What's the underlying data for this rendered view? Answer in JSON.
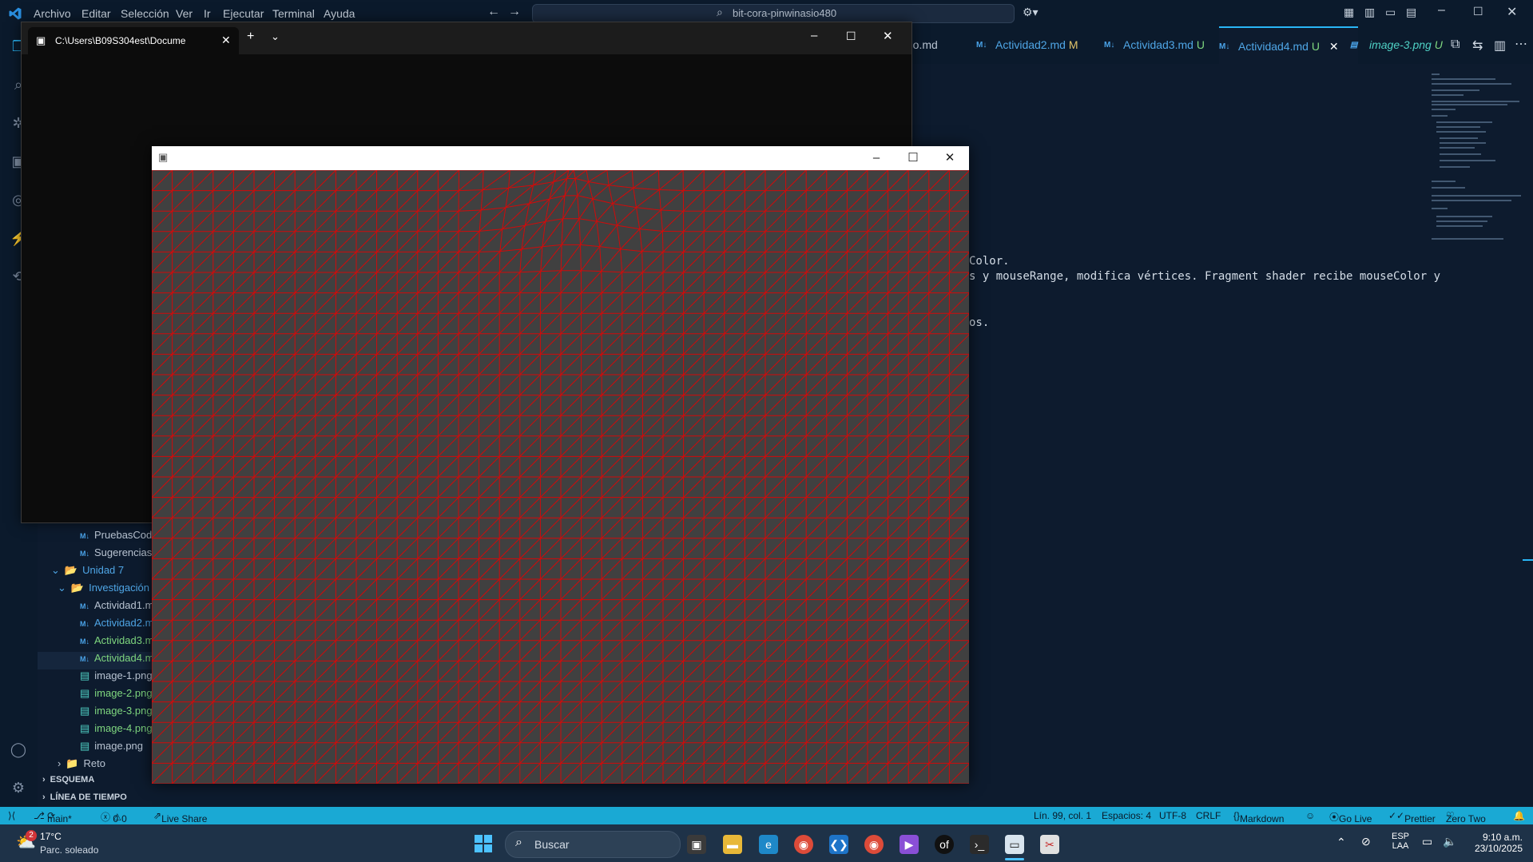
{
  "titlebar": {
    "menus": [
      "Archivo",
      "Editar",
      "Selección",
      "Ver",
      "Ir",
      "Ejecutar",
      "Terminal",
      "Ayuda"
    ],
    "search": "bit-cora-pinwinasio480"
  },
  "tabs": [
    {
      "label": "digo.md",
      "state": ""
    },
    {
      "label": "Actividad2.md",
      "state": "M"
    },
    {
      "label": "Actividad3.md",
      "state": "U"
    },
    {
      "label": "Actividad4.md",
      "state": "U",
      "active": true
    },
    {
      "label": "image-3.png",
      "state": "U"
    }
  ],
  "editor": {
    "lines": [
      "Color.",
      "s y mouseRange, modifica vértices. Fragment shader recibe mouseColor y",
      "os."
    ]
  },
  "explorer": {
    "items": [
      {
        "label": "PruebasCod",
        "kind": "md"
      },
      {
        "label": "Sugerencias",
        "kind": "md"
      },
      {
        "label": "Unidad 7",
        "kind": "folder-open"
      },
      {
        "label": "Investigación",
        "kind": "folder-open"
      },
      {
        "label": "Actividad1.m",
        "kind": "md"
      },
      {
        "label": "Actividad2.m",
        "kind": "md"
      },
      {
        "label": "Actividad3.m",
        "kind": "md"
      },
      {
        "label": "Actividad4.m",
        "kind": "md"
      },
      {
        "label": "image-1.png",
        "kind": "img"
      },
      {
        "label": "image-2.png",
        "kind": "img"
      },
      {
        "label": "image-3.png",
        "kind": "img"
      },
      {
        "label": "image-4.png",
        "kind": "img"
      },
      {
        "label": "image.png",
        "kind": "img"
      },
      {
        "label": "Reto",
        "kind": "folder"
      }
    ],
    "sections": [
      "ESQUEMA",
      "LÍNEA DE TIEMPO"
    ]
  },
  "statusbar": {
    "branch": "main*",
    "problems": "0",
    "warnings": "0",
    "liveshare": "Live Share",
    "position": "Lín. 99, col. 1",
    "spaces": "Espacios: 4",
    "encoding": "UTF-8",
    "eol": "CRLF",
    "language": "Markdown",
    "golive": "Go Live",
    "prettier": "Prettier",
    "theme": "Zero Two"
  },
  "terminal": {
    "tab_title": "C:\\Users\\B09S304est\\Docume"
  },
  "taskbar": {
    "weather_temp": "17°C",
    "weather_desc": "Parc. soleado",
    "weather_badge": "2",
    "search_placeholder": "Buscar",
    "lang": "ESP",
    "layout": "LAA",
    "time": "9:10 a.m.",
    "date": "23/10/2025"
  },
  "colors": {
    "accent": "#1aa9d4",
    "mesh_line": "#d10a0a",
    "mesh_bg": "#404040"
  }
}
